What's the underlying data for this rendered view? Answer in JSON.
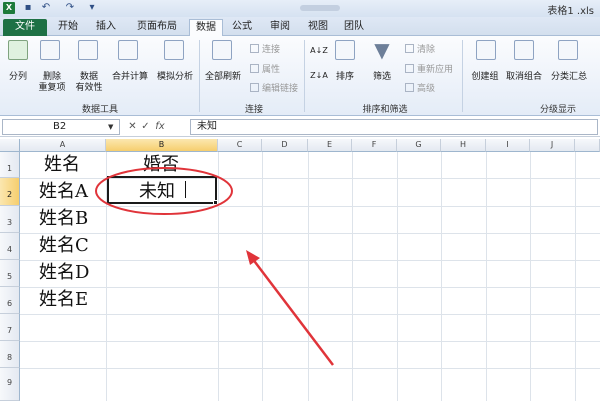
{
  "title_bar": {
    "filename": "表格1 .xls"
  },
  "tabs": [
    "文件",
    "开始",
    "插入",
    "页面布局",
    "数据",
    "公式",
    "审阅",
    "视图",
    "团队"
  ],
  "ribbon": {
    "data_tools": {
      "btn1": "分列",
      "btn2_line1": "删除",
      "btn2_line2": "重复项",
      "btn3_line1": "数据",
      "btn3_line2": "有效性",
      "btn4": "合并计算",
      "btn5": "模拟分析",
      "group": "数据工具"
    },
    "connections": {
      "refresh": "全部刷新",
      "conn": "连接",
      "props": "属性",
      "edit_links": "编辑链接",
      "group": "连接"
    },
    "sort_filter": {
      "sort_az": "A↓Z",
      "sort_za": "Z↓A",
      "sort": "排序",
      "filter": "筛选",
      "clear": "清除",
      "reapply": "重新应用",
      "advanced": "高级",
      "group": "排序和筛选"
    },
    "outline": {
      "group_btn": "创建组",
      "ungroup": "取消组合",
      "subtotal": "分类汇总",
      "group": "分级显示"
    }
  },
  "formula_bar": {
    "name_box": "B2",
    "fx": "fx",
    "value": "未知"
  },
  "columns": [
    "A",
    "B",
    "C",
    "D",
    "E",
    "F",
    "G",
    "H",
    "I",
    "J"
  ],
  "rows": [
    "1",
    "2",
    "3",
    "4",
    "5",
    "6",
    "7",
    "8",
    "9"
  ],
  "cells": {
    "A1": "姓名",
    "B1": "婚否",
    "A2": "姓名A",
    "B2": "未知",
    "A3": "姓名B",
    "A4": "姓名C",
    "A5": "姓名D",
    "A6": "姓名E"
  },
  "annotation_color": "#e0343a"
}
